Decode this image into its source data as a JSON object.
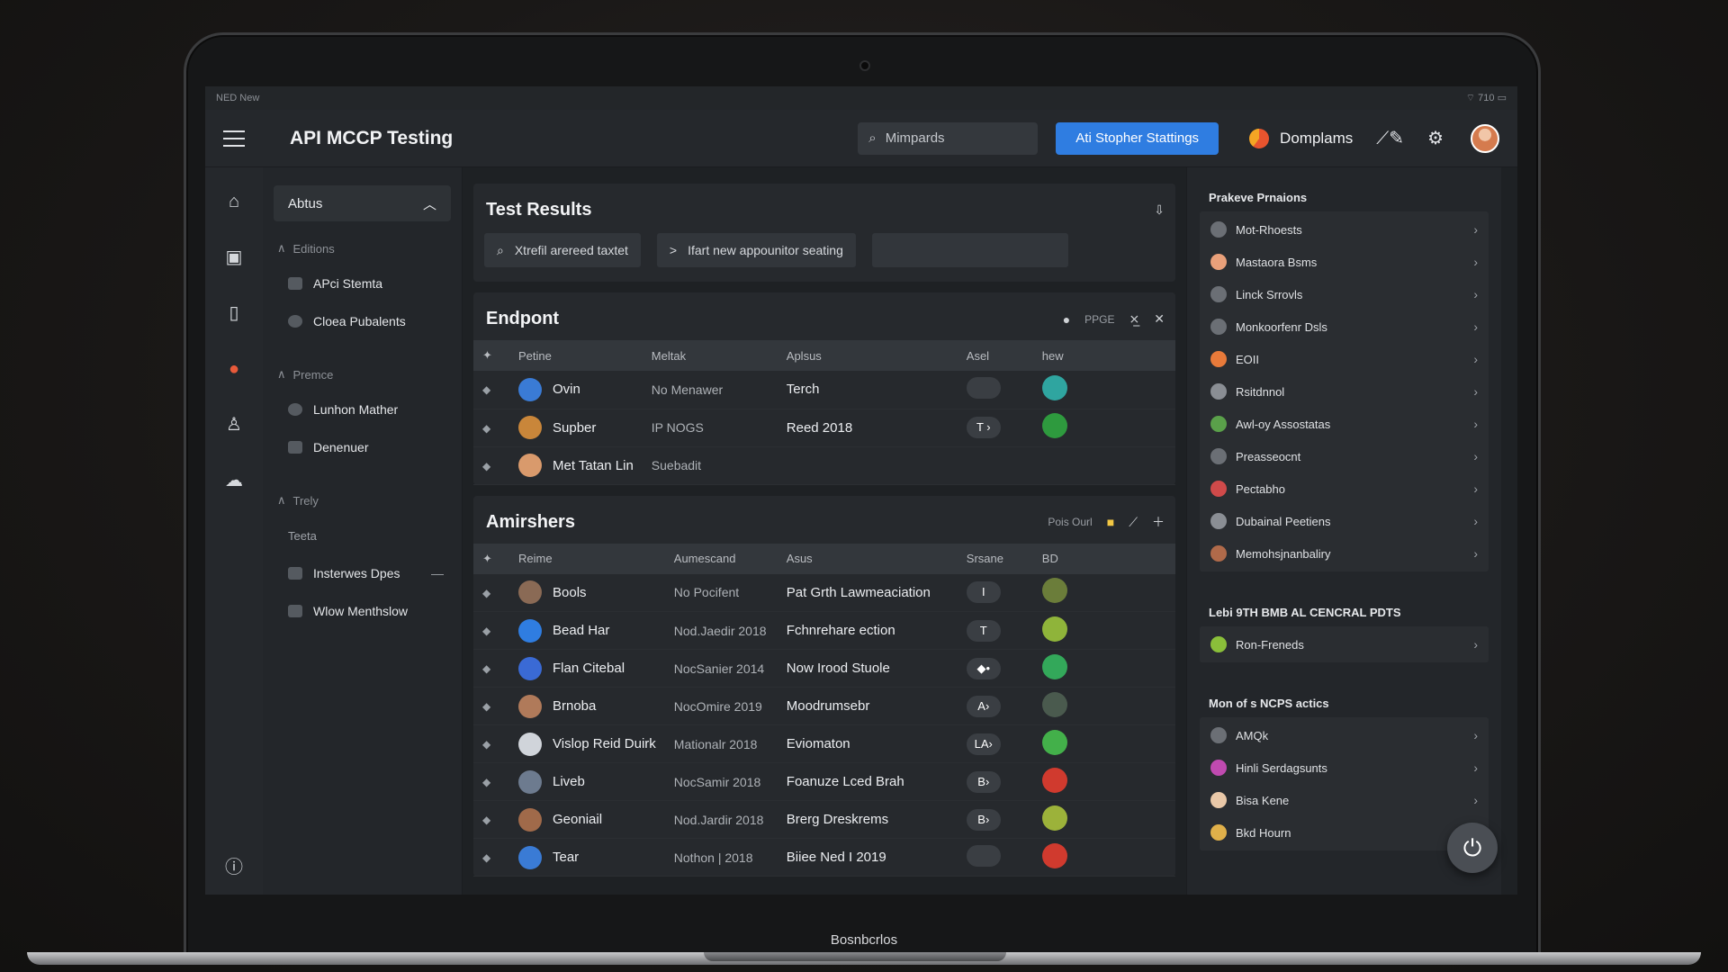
{
  "statusbar": {
    "left": "NED New",
    "right": "710"
  },
  "app": {
    "title": "API MCCP Testing"
  },
  "topbar": {
    "search_placeholder": "Mimpards",
    "primary_button": "Ati Stopher Stattings",
    "brand": "Domplams"
  },
  "nav": {
    "head": "Abtus",
    "sections": [
      {
        "label": "Editions",
        "items": [
          "APci Stemta",
          "Cloea Pubalents"
        ]
      },
      {
        "label": "Premce",
        "items": [
          "Lunhon Mather",
          "Denenuer"
        ]
      },
      {
        "label": "Trely",
        "plain": "Teeta",
        "items": [
          "Insterwes Dpes",
          "Wlow Menthslow"
        ]
      }
    ]
  },
  "test_results": {
    "title": "Test Results",
    "filter1": "Xtrefil arereed taxtet",
    "filter2": "Ifart new appounitor seating"
  },
  "endpoint": {
    "title": "Endpont",
    "tool_label": "PPGE",
    "columns": [
      "Petine",
      "Meltak",
      "Aplsus",
      "Asel",
      "hew"
    ],
    "rows": [
      {
        "name": "Ovin",
        "col2": "No Menawer",
        "col3": "Terch",
        "badge": "",
        "dot": "#2fa5a0"
      },
      {
        "name": "Supber",
        "col2": "IP NOGS",
        "col3": "Reed 2018",
        "badge": "T ›",
        "dot": "#2e9a3e"
      },
      {
        "name": "Met Tatan Lin",
        "col2": "Suebadit",
        "col3": "",
        "badge": "",
        "dot": ""
      }
    ]
  },
  "amirshers": {
    "title": "Amirshers",
    "tool_label": "Pois Ourl",
    "columns": [
      "Reime",
      "Aumescand",
      "Asus",
      "Srsane",
      "BD"
    ],
    "rows": [
      {
        "name": "Bools",
        "col2": "No Pocifent",
        "col3": "Pat Grth Lawmeaciation",
        "badge": "I",
        "dot": "#6b7d3a"
      },
      {
        "name": "Bead Har",
        "col2": "Nod.Jaedir 2018",
        "col3": "Fchnrehare ection",
        "badge": "T",
        "dot": "#8fb43a"
      },
      {
        "name": "Flan Citebal",
        "col2": "NocSanier 2014",
        "col3": "Now Irood Stuole",
        "badge": "◆•",
        "dot": "#33a85a"
      },
      {
        "name": "Brnoba",
        "col2": "NocOmire 2019",
        "col3": "Moodrumsebr",
        "badge": "A›",
        "dot": "#4a5a4e"
      },
      {
        "name": "Vislop Reid Duirk",
        "col2": "Mationalr 2018",
        "col3": "Eviomaton",
        "badge": "LA›",
        "dot": "#43b04a"
      },
      {
        "name": "Liveb",
        "col2": "NocSamir 2018",
        "col3": "Foanuze Lced Brah",
        "badge": "B›",
        "dot": "#d03a2e"
      },
      {
        "name": "Geoniail",
        "col2": "Nod.Jardir 2018",
        "col3": "Brerg Dreskrems",
        "badge": "B›",
        "dot": "#9cb23a"
      },
      {
        "name": "Tear",
        "col2": "Nothon | 2018",
        "col3": "Biiee Ned I 2019",
        "badge": "",
        "dot": "#d03a2e"
      }
    ]
  },
  "right_panel": {
    "sections": [
      {
        "label": "Prakeve Prnaions",
        "items": [
          "Mot-Rhoests",
          "Mastaora Bsms",
          "Linck Srrovls",
          "Monkoorfenr Dsls",
          "EOII",
          "Rsitdnnol",
          "Awl-oy Assostatas",
          "Preasseocnt",
          "Pectabho",
          "Dubainal Peetiens",
          "Memohsjnanbaliry"
        ]
      },
      {
        "label": "Lebi 9TH BMB AL CENCRAL PDTS",
        "items": [
          "Ron-Freneds"
        ]
      },
      {
        "label": "Mon of s NCPS actics",
        "items": [
          "AMQk",
          "Hinli Serdagsunts",
          "Bisa Kene",
          "Bkd Hourn"
        ]
      }
    ]
  },
  "bottom_label": "Bosnbcrlos",
  "colors": {
    "accent": "#2f7de1",
    "bg": "#1e2124"
  }
}
